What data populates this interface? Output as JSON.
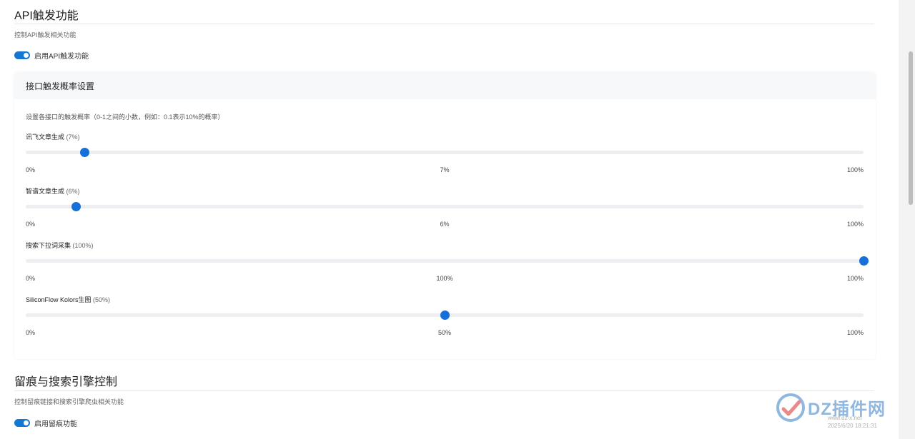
{
  "api_section": {
    "title": "API触发功能",
    "description": "控制API触发相关功能",
    "toggle_label": "启用API触发功能",
    "toggle_on": true
  },
  "probability_card": {
    "header": "接口触发概率设置",
    "description": "设置各接口的触发概率（0-1之间的小数，例如：0.1表示10%的概率）",
    "sliders": [
      {
        "name": "讯飞文章生成",
        "pct_label": "(7%)",
        "value": 0.07,
        "min_label": "0%",
        "mid_label": "7%",
        "max_label": "100%"
      },
      {
        "name": "智谱文章生成",
        "pct_label": "(6%)",
        "value": 0.06,
        "min_label": "0%",
        "mid_label": "6%",
        "max_label": "100%"
      },
      {
        "name": "搜索下拉词采集",
        "pct_label": "(100%)",
        "value": 1.0,
        "min_label": "0%",
        "mid_label": "100%",
        "max_label": "100%"
      },
      {
        "name": "SiliconFlow Kolors生图",
        "pct_label": "(50%)",
        "value": 0.5,
        "min_label": "0%",
        "mid_label": "50%",
        "max_label": "100%"
      }
    ]
  },
  "trace_section": {
    "title": "留痕与搜索引擎控制",
    "description": "控制留痕链接和搜索引擎爬虫相关功能",
    "toggle_label": "启用留痕功能",
    "toggle_on": true
  },
  "watermark": {
    "brand": "DZ插件网",
    "url": "www.dz-x.net",
    "date": "2025/6/20 18:21:31"
  },
  "colors": {
    "accent": "#1570d9",
    "track": "#eceef1",
    "card_header_bg": "#f7f8fa"
  }
}
